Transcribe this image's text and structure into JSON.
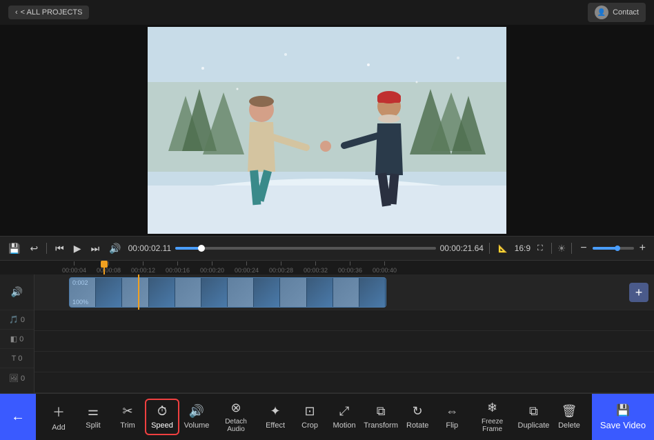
{
  "topBar": {
    "backLabel": "< ALL PROJECTS",
    "contactLabel": "Contact"
  },
  "transport": {
    "currentTime": "00:00:02.11",
    "totalTime": "00:00:21.64",
    "aspectRatio": "16:9",
    "progress": 10
  },
  "timeline": {
    "rulerMarks": [
      "00:00:04",
      "00:00:08",
      "00:00:12",
      "00:00:16",
      "00:00:20",
      "00:00:24",
      "00:00:28",
      "00:00:32",
      "00:00:36",
      "00:00:40"
    ],
    "videoClipLabel": "0:002",
    "videoClipPercentage": "100%"
  },
  "toolbar": {
    "backIcon": "←",
    "tools": [
      {
        "id": "add",
        "icon": "+",
        "label": "Add"
      },
      {
        "id": "split",
        "icon": "⊪",
        "label": "Split"
      },
      {
        "id": "trim",
        "icon": "✂",
        "label": "Trim"
      },
      {
        "id": "speed",
        "icon": "⏱",
        "label": "Speed",
        "active": true
      },
      {
        "id": "volume",
        "icon": "♪",
        "label": "Volume"
      },
      {
        "id": "detach-audio",
        "icon": "⊗",
        "label": "Detach Audio"
      },
      {
        "id": "effect",
        "icon": "✦",
        "label": "Effect"
      },
      {
        "id": "crop",
        "icon": "⊡",
        "label": "Crop"
      },
      {
        "id": "motion",
        "icon": "⤢",
        "label": "Motion"
      },
      {
        "id": "transform",
        "icon": "⧉",
        "label": "Transform"
      },
      {
        "id": "rotate",
        "icon": "↻",
        "label": "Rotate"
      },
      {
        "id": "flip",
        "icon": "⇔",
        "label": "Flip"
      },
      {
        "id": "freeze-frame",
        "icon": "❄",
        "label": "Freeze Frame"
      },
      {
        "id": "duplicate",
        "icon": "⧉",
        "label": "Duplicate"
      },
      {
        "id": "delete",
        "icon": "🗑",
        "label": "Delete"
      }
    ],
    "saveLabel": "Save Video",
    "saveIcon": "💾"
  }
}
